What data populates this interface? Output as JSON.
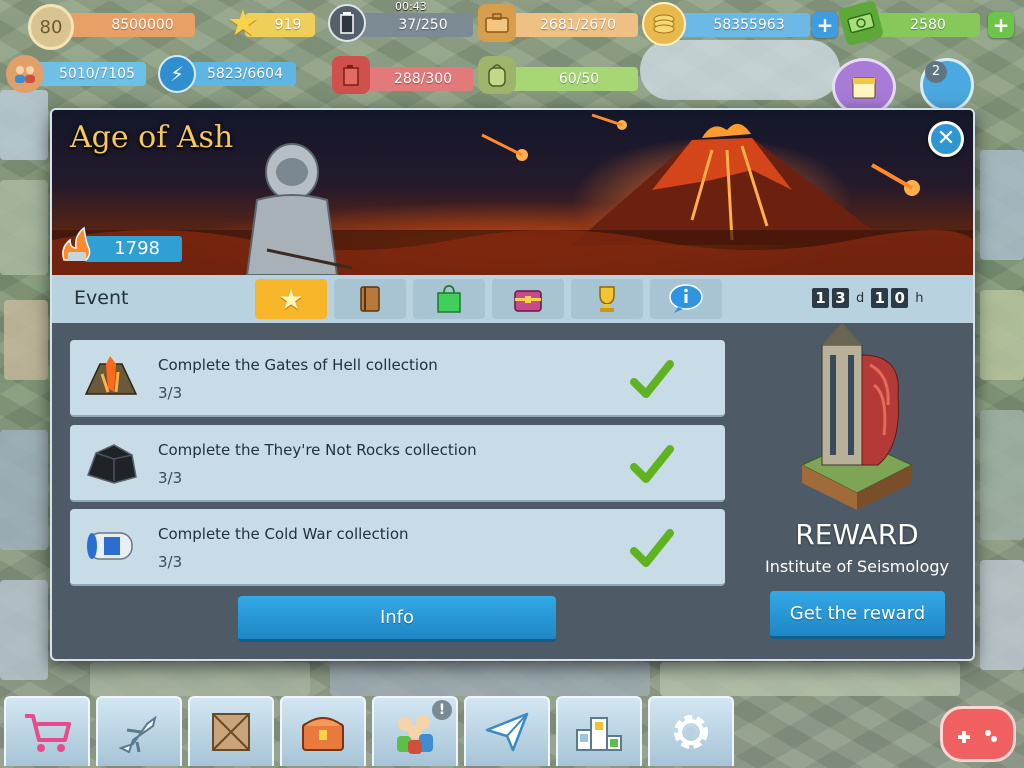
{
  "hud": {
    "level": "80",
    "coins": "8500000",
    "stars": "919",
    "time": "00:43",
    "fuel": "37/250",
    "jobs": "2681/2670",
    "money": "58355963",
    "cash": "2580",
    "population": "5010/7105",
    "energy": "5823/6604",
    "kerosene": "288/300",
    "cargo": "60/50",
    "notifications": "2"
  },
  "modal": {
    "title": "Age of Ash",
    "score": "1798",
    "tab_label": "Event",
    "tabs": [
      {
        "icon": "star-icon",
        "active": true
      },
      {
        "icon": "book-icon",
        "active": false
      },
      {
        "icon": "shopping-bag-icon",
        "active": false
      },
      {
        "icon": "chest-icon",
        "active": false
      },
      {
        "icon": "trophy-icon",
        "active": false
      },
      {
        "icon": "info-icon",
        "active": false
      }
    ],
    "timer": {
      "days": [
        "1",
        "3"
      ],
      "days_unit": "d",
      "hours": [
        "1",
        "0"
      ],
      "hours_unit": "h"
    },
    "tasks": [
      {
        "title": "Complete the Gates of Hell collection",
        "progress": "3/3",
        "icon": "volcano-rock-icon"
      },
      {
        "title": "Complete the They're Not Rocks collection",
        "progress": "3/3",
        "icon": "black-rock-icon"
      },
      {
        "title": "Complete the Cold War collection",
        "progress": "3/3",
        "icon": "canister-icon"
      }
    ],
    "info_button": "Info",
    "reward_title": "REWARD",
    "reward_name": "Institute of Seismology",
    "reward_button": "Get the reward"
  },
  "colors": {
    "accent_blue": "#2f9fd4",
    "tab_active": "#f7b52a",
    "check_green": "#5fb31f"
  }
}
